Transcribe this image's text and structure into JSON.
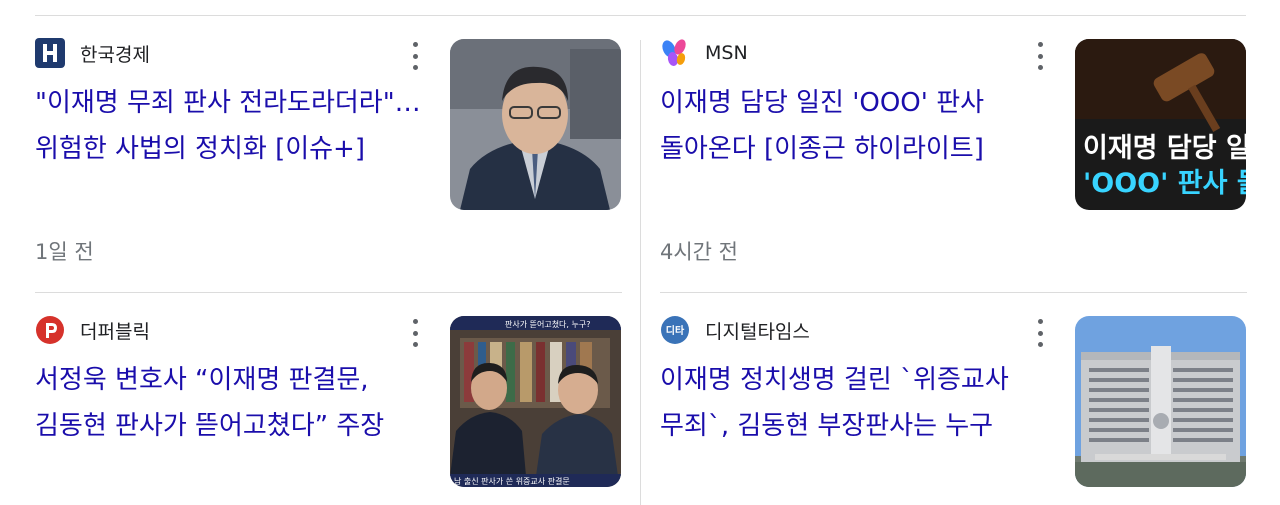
{
  "articles": [
    {
      "source": "한국경제",
      "source_icon": "hankyung-logo-icon",
      "title": "\"이재명 무죄 판사 전라도라더라\"…위험한 사법의 정치화 [이슈+]",
      "time": "1일 전",
      "thumbnail": "photo-man-in-suit"
    },
    {
      "source": "MSN",
      "source_icon": "msn-logo-icon",
      "title": "이재명 담당 일진 'OOO' 판사 돌아온다 [이종근 하이라이트]",
      "time": "4시간 전",
      "thumbnail": "photo-gavel",
      "thumbnail_text": [
        "이재명 담당 일",
        "'OOO' 판사 돌"
      ]
    },
    {
      "source": "더퍼블릭",
      "source_icon": "thepublic-logo-icon",
      "title": "서정욱 변호사 “이재명 판결문, 김동현 판사가 뜯어고쳤다” 주장",
      "time": "",
      "thumbnail": "photo-two-men-broadcast",
      "thumbnail_text": [
        "판사가 뜯어고쳤다, 누구?",
        "남 출신 판사가 쓴 위증교사 판결문"
      ]
    },
    {
      "source": "디지털타임스",
      "source_icon": "dt-logo-icon",
      "logo_text": "디타",
      "title": "이재명 정치생명 걸린 `위증교사 무죄`, 김동현 부장판사는 누구",
      "time": "",
      "thumbnail": "photo-court-building"
    }
  ],
  "colors": {
    "link": "#1a0dab",
    "meta": "#70757a",
    "divider": "#dcdcdc",
    "hankyung": "#1f3a6e",
    "thepublic": "#d6322b",
    "dt": "#3a73b8"
  }
}
